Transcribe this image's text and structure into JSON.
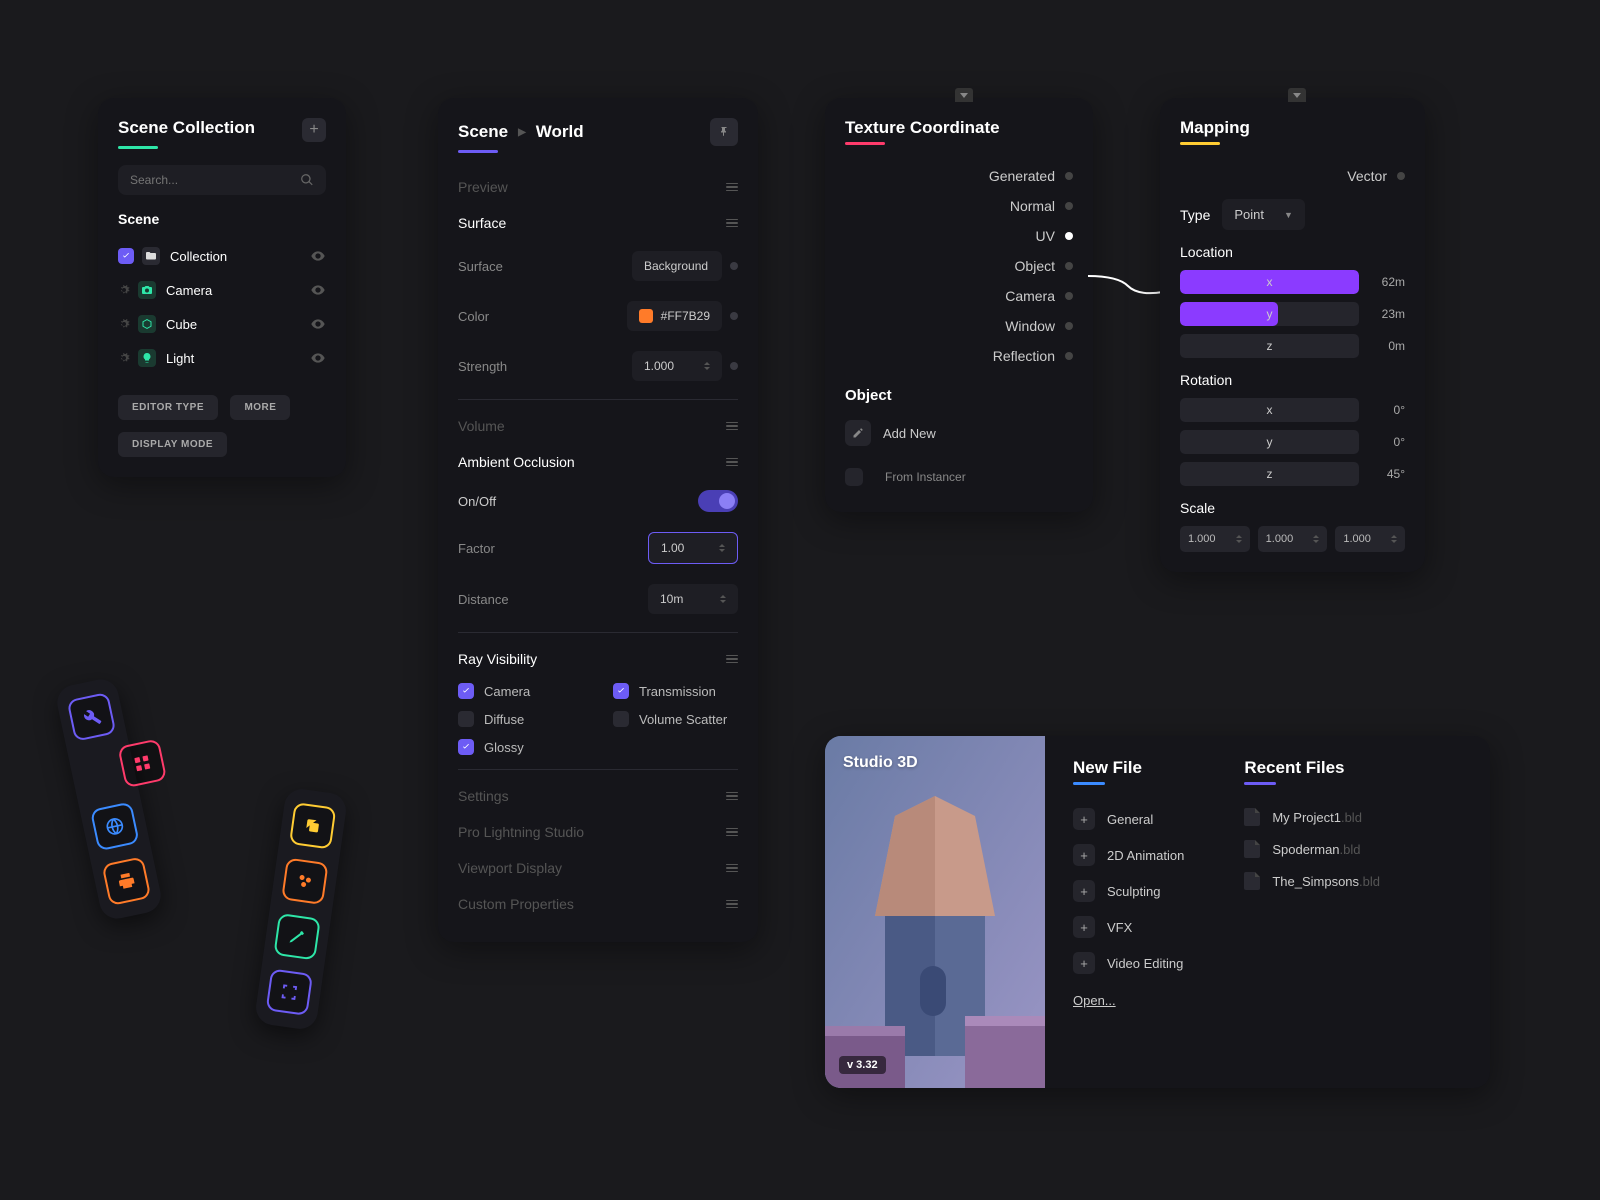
{
  "scene_collection": {
    "title": "Scene Collection",
    "search_placeholder": "Search...",
    "scene_label": "Scene",
    "items": [
      {
        "label": "Collection",
        "icon_color": "#ffffff",
        "icon_bg": "#2a2a32"
      },
      {
        "label": "Camera",
        "icon_color": "#2ee6a8",
        "icon_bg": "#1a3a30"
      },
      {
        "label": "Cube",
        "icon_color": "#2ee6a8",
        "icon_bg": "#1a3a30"
      },
      {
        "label": "Light",
        "icon_color": "#2ee6a8",
        "icon_bg": "#1a3a30"
      }
    ],
    "buttons": {
      "editor_type": "EDITOR TYPE",
      "more": "MORE",
      "display_mode": "DISPLAY MODE"
    }
  },
  "properties": {
    "breadcrumb": {
      "scene": "Scene",
      "world": "World"
    },
    "sections": {
      "preview": "Preview",
      "surface": "Surface",
      "volume": "Volume",
      "ambient_occlusion": "Ambient Occlusion",
      "ray_visibility": "Ray Visibility",
      "settings": "Settings",
      "pro_lightning": "Pro Lightning Studio",
      "viewport_display": "Viewport Display",
      "custom_properties": "Custom Properties"
    },
    "surface_props": {
      "surface_label": "Surface",
      "surface_value": "Background",
      "color_label": "Color",
      "color_value": "#FF7B29",
      "color_swatch": "#FF7B29",
      "strength_label": "Strength",
      "strength_value": "1.000"
    },
    "ao_props": {
      "onoff_label": "On/Off",
      "factor_label": "Factor",
      "factor_value": "1.00",
      "distance_label": "Distance",
      "distance_value": "10m"
    },
    "ray_checks": {
      "camera": "Camera",
      "diffuse": "Diffuse",
      "glossy": "Glossy",
      "transmission": "Transmission",
      "volume_scatter": "Volume Scatter"
    }
  },
  "texture_coord": {
    "title": "Texture Coordinate",
    "outputs": [
      "Generated",
      "Normal",
      "UV",
      "Object",
      "Camera",
      "Window",
      "Reflection"
    ],
    "object_label": "Object",
    "add_new": "Add New",
    "from_instancer": "From Instancer"
  },
  "mapping": {
    "title": "Mapping",
    "vector_out": "Vector",
    "type_label": "Type",
    "type_value": "Point",
    "location_label": "Location",
    "location": {
      "x": "62m",
      "y": "23m",
      "z": "0m"
    },
    "rotation_label": "Rotation",
    "rotation": {
      "x": "0°",
      "y": "0°",
      "z": "45°"
    },
    "scale_label": "Scale",
    "scale": {
      "x": "1.000",
      "y": "1.000",
      "z": "1.000"
    }
  },
  "welcome": {
    "app_title": "Studio 3D",
    "version": "v 3.32",
    "new_file_label": "New File",
    "recent_files_label": "Recent Files",
    "new_file_options": [
      "General",
      "2D Animation",
      "Sculpting",
      "VFX",
      "Video Editing"
    ],
    "open_label": "Open...",
    "recent_files": [
      {
        "name": "My Project1",
        "ext": ".bld"
      },
      {
        "name": "Spoderman",
        "ext": ".bld"
      },
      {
        "name": "The_Simpsons",
        "ext": ".bld"
      }
    ]
  },
  "axes": {
    "x": "x",
    "y": "y",
    "z": "z"
  }
}
